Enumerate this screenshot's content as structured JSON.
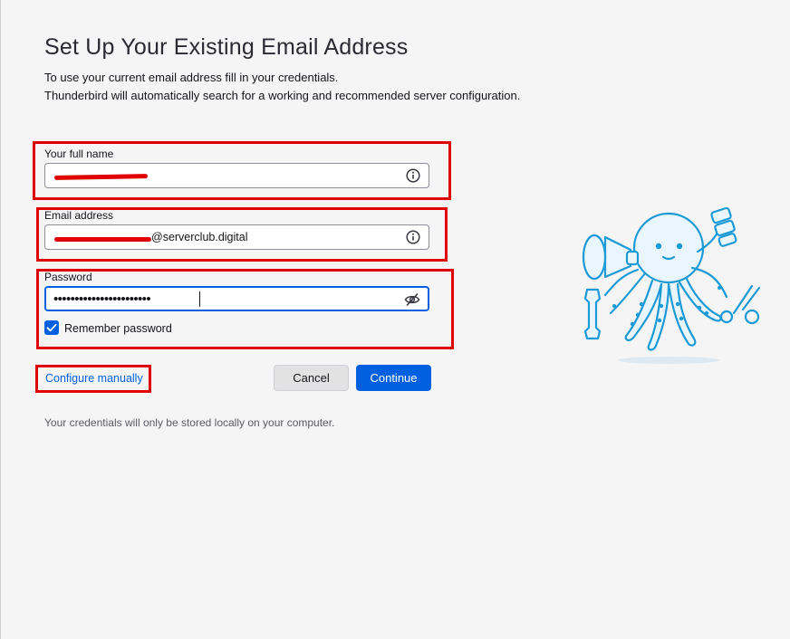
{
  "title": "Set Up Your Existing Email Address",
  "intro": {
    "line1": "To use your current email address fill in your credentials.",
    "line2": "Thunderbird will automatically search for a working and recommended server configuration."
  },
  "full_name": {
    "label": "Your full name",
    "value": ""
  },
  "email": {
    "label": "Email address",
    "value_visible": "@serverclub.digital"
  },
  "password": {
    "label": "Password",
    "masked": "•••••••••••••••••••••••"
  },
  "remember": {
    "label": "Remember password",
    "checked": true
  },
  "configure_manually": "Configure manually",
  "buttons": {
    "cancel": "Cancel",
    "continue": "Continue"
  },
  "footnote": "Your credentials will only be stored locally on your computer.",
  "colors": {
    "accent": "#0060df",
    "highlight": "#e00000",
    "background": "#f5f5f5"
  },
  "icons": {
    "info": "info-icon",
    "reveal_password": "eye-slash-icon",
    "checkbox": "checkmark-icon",
    "mascot": "octopus-mascot"
  }
}
